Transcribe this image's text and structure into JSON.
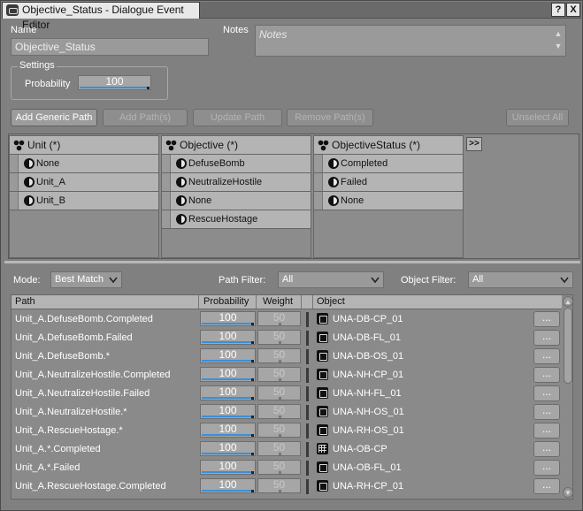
{
  "window": {
    "title": "Objective_Status - Dialogue Event Editor",
    "help_label": "?",
    "close_label": "X"
  },
  "form": {
    "name_label": "Name",
    "name_value": "Objective_Status",
    "notes_label": "Notes",
    "notes_placeholder": "Notes",
    "settings_legend": "Settings",
    "probability_label": "Probability",
    "probability_value": "100",
    "probability_fraction": 1.0
  },
  "toolbar": {
    "add_generic_path": "Add Generic Path",
    "add_paths": "Add Path(s)",
    "update_path": "Update Path",
    "remove_paths": "Remove Path(s)",
    "unselect_all": "Unselect All"
  },
  "columns": [
    {
      "header": "Unit (*)",
      "items": [
        "None",
        "Unit_A",
        "Unit_B"
      ]
    },
    {
      "header": "Objective (*)",
      "items": [
        "DefuseBomb",
        "NeutralizeHostile",
        "None",
        "RescueHostage"
      ]
    },
    {
      "header": "ObjectiveStatus (*)",
      "items": [
        "Completed",
        "Failed",
        "None"
      ]
    }
  ],
  "expand_label": ">>",
  "filters": {
    "mode_label": "Mode:",
    "mode_value": "Best Match",
    "path_filter_label": "Path Filter:",
    "path_filter_value": "All",
    "object_filter_label": "Object Filter:",
    "object_filter_value": "All"
  },
  "table": {
    "headers": {
      "path": "Path",
      "probability": "Probability",
      "weight": "Weight",
      "object": "Object"
    },
    "more_label": "...",
    "rows": [
      {
        "path": "Unit_A.DefuseBomb.Completed",
        "probability": "100",
        "weight": "50",
        "object": "UNA-DB-CP_01",
        "icon": "sound-icon"
      },
      {
        "path": "Unit_A.DefuseBomb.Failed",
        "probability": "100",
        "weight": "50",
        "object": "UNA-DB-FL_01",
        "icon": "sound-icon"
      },
      {
        "path": "Unit_A.DefuseBomb.*",
        "probability": "100",
        "weight": "50",
        "object": "UNA-DB-OS_01",
        "icon": "sound-icon"
      },
      {
        "path": "Unit_A.NeutralizeHostile.Completed",
        "probability": "100",
        "weight": "50",
        "object": "UNA-NH-CP_01",
        "icon": "sound-icon"
      },
      {
        "path": "Unit_A.NeutralizeHostile.Failed",
        "probability": "100",
        "weight": "50",
        "object": "UNA-NH-FL_01",
        "icon": "sound-icon"
      },
      {
        "path": "Unit_A.NeutralizeHostile.*",
        "probability": "100",
        "weight": "50",
        "object": "UNA-NH-OS_01",
        "icon": "sound-icon"
      },
      {
        "path": "Unit_A.RescueHostage.*",
        "probability": "100",
        "weight": "50",
        "object": "UNA-RH-OS_01",
        "icon": "sound-icon"
      },
      {
        "path": "Unit_A.*.Completed",
        "probability": "100",
        "weight": "50",
        "object": "UNA-OB-CP",
        "icon": "container-icon"
      },
      {
        "path": "Unit_A.*.Failed",
        "probability": "100",
        "weight": "50",
        "object": "UNA-OB-FL_01",
        "icon": "sound-icon"
      },
      {
        "path": "Unit_A.RescueHostage.Completed",
        "probability": "100",
        "weight": "50",
        "object": "UNA-RH-CP_01",
        "icon": "sound-icon"
      }
    ]
  }
}
